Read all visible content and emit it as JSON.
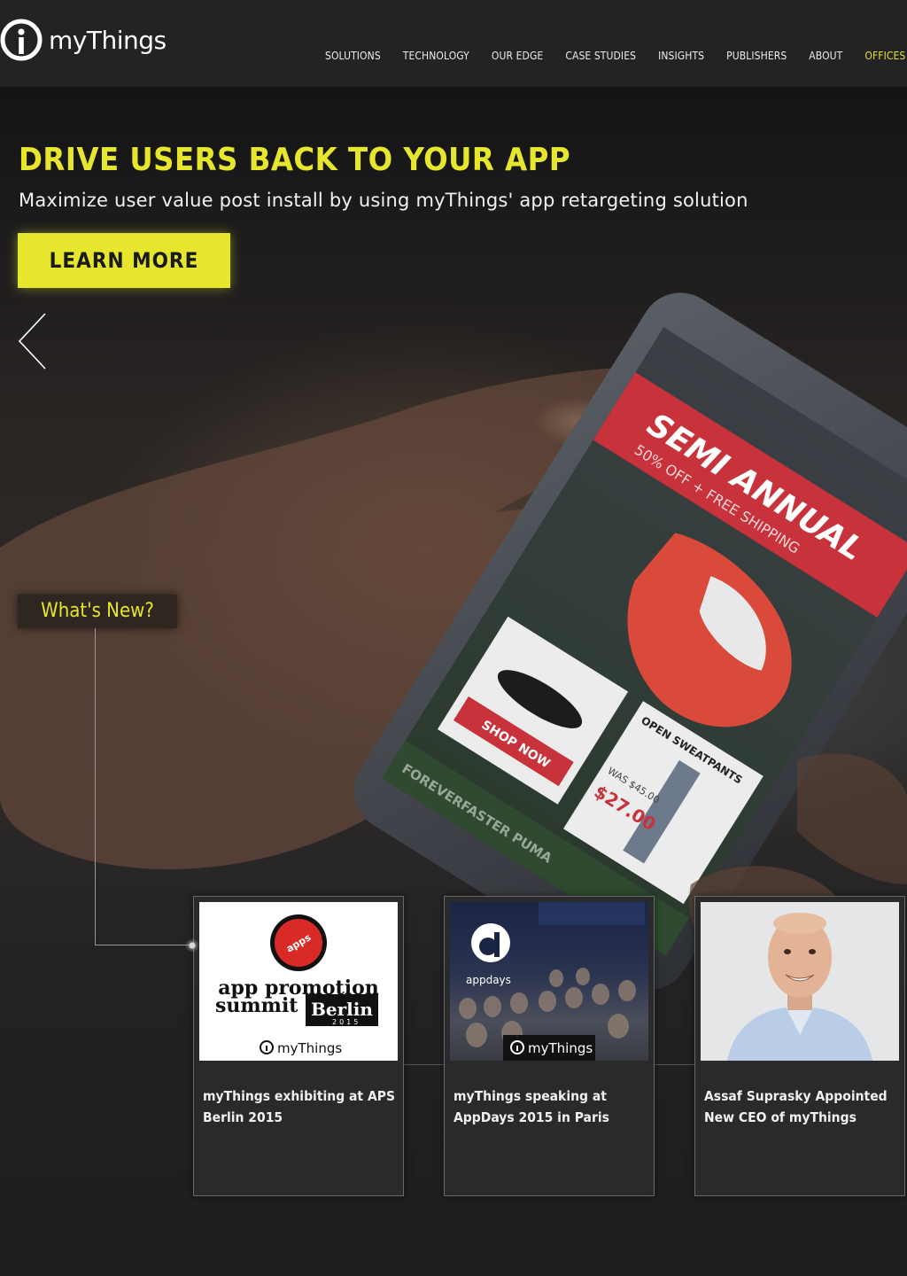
{
  "brand": {
    "logo_text": "myThings"
  },
  "nav": {
    "items": [
      {
        "label": "SOLUTIONS"
      },
      {
        "label": "TECHNOLOGY"
      },
      {
        "label": "OUR EDGE"
      },
      {
        "label": "CASE STUDIES"
      },
      {
        "label": "INSIGHTS"
      },
      {
        "label": "PUBLISHERS"
      },
      {
        "label": "ABOUT"
      },
      {
        "label": "OFFICES"
      }
    ],
    "active_item": "OFFICES",
    "active_color": "#e3e32a"
  },
  "hero": {
    "headline": "DRIVE USERS BACK TO YOUR APP",
    "subhead": "Maximize user value post install by using myThings' app retargeting solution",
    "cta_label": "LEARN MORE",
    "accent_color": "#e6e62c",
    "phone_screen": {
      "banner_line1": "SEMI ANNUAL",
      "banner_line2": "50% OFF + FREE SHIPPING",
      "shop_now": "SHOP NOW",
      "product_title": "OPEN SWEATPANTS",
      "was_price": "WAS $45.00",
      "price": "$27.00",
      "footer_text": "FOREVERFASTER PUMA"
    }
  },
  "whats_new": {
    "label": "What's New?",
    "cards": [
      {
        "title": "myThings exhibiting at APS Berlin 2015",
        "image": {
          "badge_text": "apps",
          "line1": "app promotion",
          "line2": "summit",
          "city": "Berlin",
          "year": "2015",
          "brand": "myThings"
        }
      },
      {
        "title": "myThings speaking at AppDays 2015 in Paris",
        "image": {
          "logo_letter": "d",
          "logo_text": "appdays",
          "brand": "myThings"
        }
      },
      {
        "title": "Assaf Suprasky Appointed New CEO of myThings",
        "image": {
          "subject": "portrait"
        }
      }
    ]
  }
}
